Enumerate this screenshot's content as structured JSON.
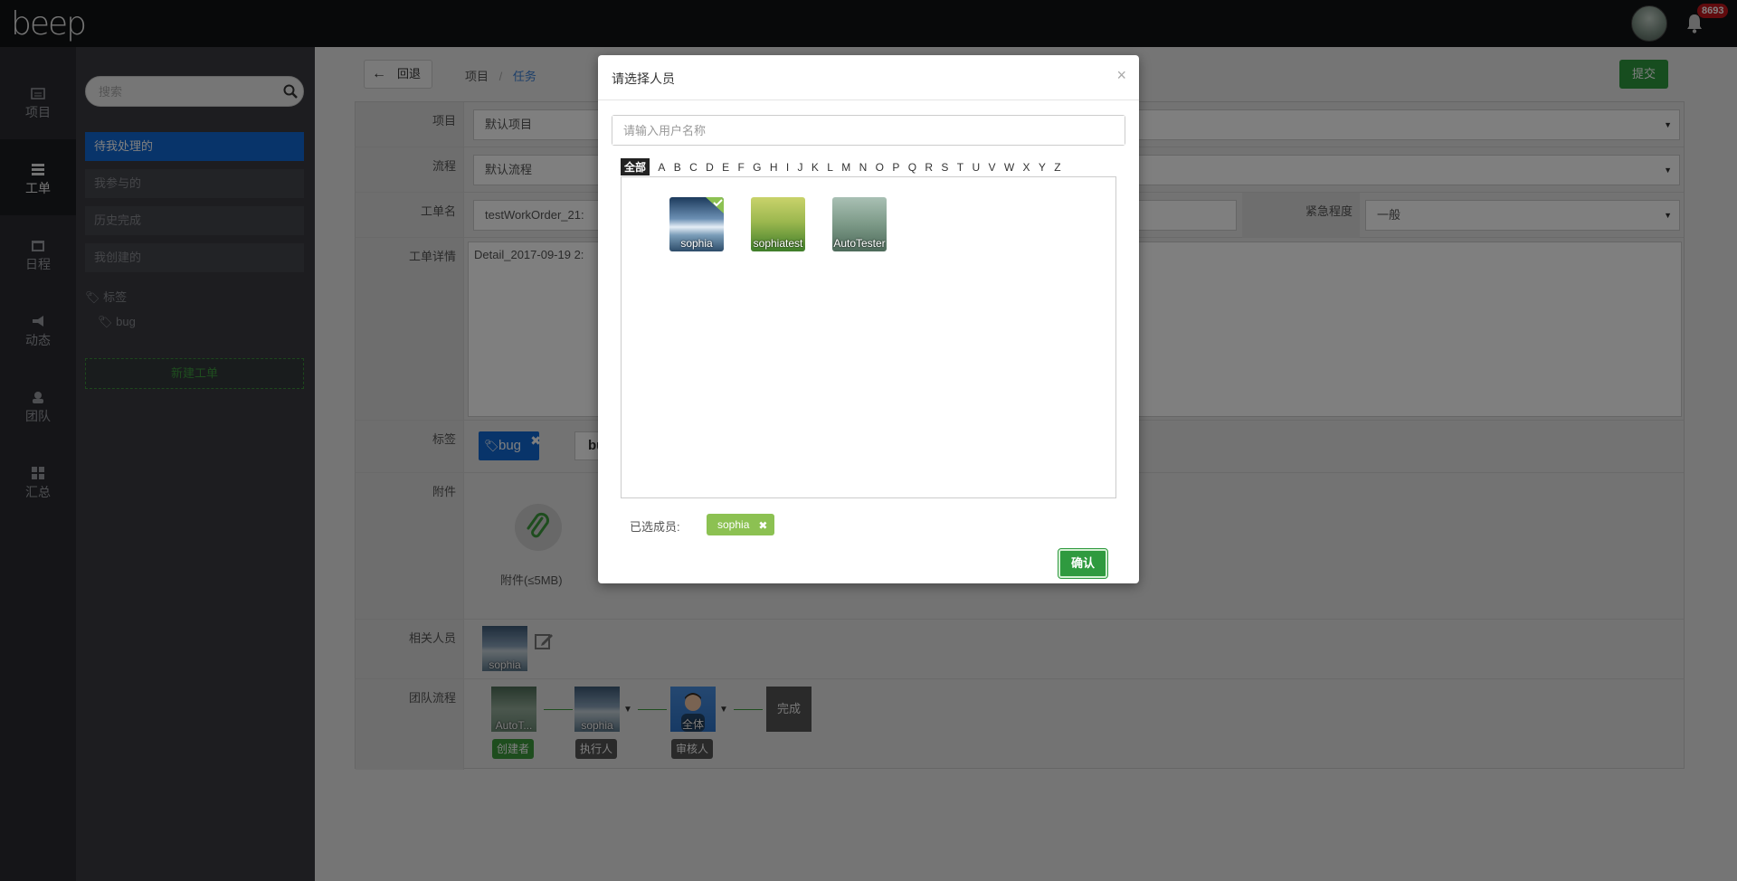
{
  "header": {
    "logo_text": "beep",
    "notification_count": "8693"
  },
  "leftnav": {
    "items": [
      {
        "label": "项目",
        "icon": "folder-icon"
      },
      {
        "label": "工单",
        "icon": "list-icon"
      },
      {
        "label": "日程",
        "icon": "calendar-icon"
      },
      {
        "label": "动态",
        "icon": "megaphone-icon"
      },
      {
        "label": "团队",
        "icon": "team-icon"
      },
      {
        "label": "汇总",
        "icon": "grid-icon"
      }
    ],
    "active_index": 1
  },
  "sidebar": {
    "search_placeholder": "搜索",
    "items": [
      {
        "label": "待我处理的",
        "active": true
      },
      {
        "label": "我参与的"
      },
      {
        "label": "历史完成"
      },
      {
        "label": "我创建的"
      }
    ],
    "tags_title": "标签",
    "tag": "bug",
    "new_button": "新建工单"
  },
  "toolbar": {
    "back_label": "回退",
    "breadcrumb": [
      "项目",
      "任务"
    ],
    "submit_label": "提交"
  },
  "form": {
    "project_label": "项目",
    "project_value": "默认项目",
    "flow_label": "流程",
    "flow_value": "默认流程",
    "name_label": "工单名",
    "name_value": "testWorkOrder_21:",
    "urgency_label": "紧急程度",
    "urgency_value": "一般",
    "detail_label": "工单详情",
    "detail_value": "Detail_2017-09-19 2:",
    "tags_label": "标签",
    "tag_selected": "bug",
    "tag_input": "bug",
    "attachments_label": "附件",
    "attachment_hint": "附件(≤5MB)",
    "related_label": "相关人员",
    "related_user": "sophia",
    "team_flow_label": "团队流程",
    "flow_nodes": [
      {
        "name": "AutoT...",
        "role": "创建者"
      },
      {
        "name": "sophia",
        "role": "执行人"
      },
      {
        "name": "全体",
        "role": "审核人"
      }
    ],
    "flow_done": "完成"
  },
  "modal": {
    "title": "请选择人员",
    "close": "×",
    "search_placeholder": "请输入用户名称",
    "letters_all": "全部",
    "letters": [
      "A",
      "B",
      "C",
      "D",
      "E",
      "F",
      "G",
      "H",
      "I",
      "J",
      "K",
      "L",
      "M",
      "N",
      "O",
      "P",
      "Q",
      "R",
      "S",
      "T",
      "U",
      "V",
      "W",
      "X",
      "Y",
      "Z"
    ],
    "users": [
      {
        "name": "sophia",
        "selected": true
      },
      {
        "name": "sophiatest",
        "selected": false
      },
      {
        "name": "AutoTester",
        "selected": false
      }
    ],
    "selected_label": "已选成员:",
    "selected_user": "sophia",
    "confirm_label": "确认"
  },
  "colors": {
    "accent_blue": "#1168d4",
    "accent_green": "#2f9a3f",
    "chip_green": "#8cc152",
    "badge_red": "#c3161c"
  }
}
